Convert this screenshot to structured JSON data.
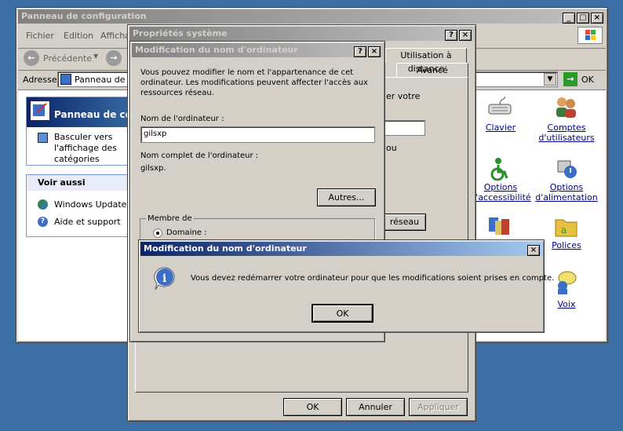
{
  "cp": {
    "title": "Panneau de configuration",
    "menu": [
      "Fichier",
      "Edition",
      "Affichage"
    ],
    "back_label": "Précédente",
    "address_label": "Adresse",
    "address_value": "Panneau de configuration",
    "go_label": "OK",
    "side_title": "Panneau de configuration",
    "switch_label": "Basculer vers l'affichage des catégories",
    "see_also": "Voir aussi",
    "see_also_items": [
      "Windows Update",
      "Aide et support"
    ],
    "icons": [
      {
        "label": "Clavier"
      },
      {
        "label": "Comptes d'utilisateurs"
      },
      {
        "label": "Options d'accessibilité"
      },
      {
        "label": "Options d'alimentation"
      },
      {
        "label": "Polices"
      },
      {
        "label": "Voix"
      }
    ]
  },
  "sys": {
    "title": "Propriétés système",
    "tab_remote": "Utilisation à distance",
    "tab_advanced": "Avancé",
    "partial_text1": "er votre",
    "partial_text2": "ou",
    "network_btn": "réseau",
    "ok": "OK",
    "cancel": "Annuler",
    "apply": "Appliquer"
  },
  "rename": {
    "title": "Modification du nom d'ordinateur",
    "desc": "Vous pouvez modifier le nom et l'appartenance de cet ordinateur. Les modifications peuvent affecter l'accès aux ressources réseau.",
    "name_label": "Nom de l'ordinateur :",
    "name_value": "gilsxp",
    "full_label": "Nom complet de l'ordinateur :",
    "full_value": "gilsxp.",
    "more_btn": "Autres...",
    "member_label": "Membre de",
    "domain_label": "Domaine :"
  },
  "msg": {
    "title": "Modification du nom d'ordinateur",
    "text": "Vous devez redémarrer votre ordinateur pour que les modifications soient prises en compte.",
    "ok": "OK"
  }
}
